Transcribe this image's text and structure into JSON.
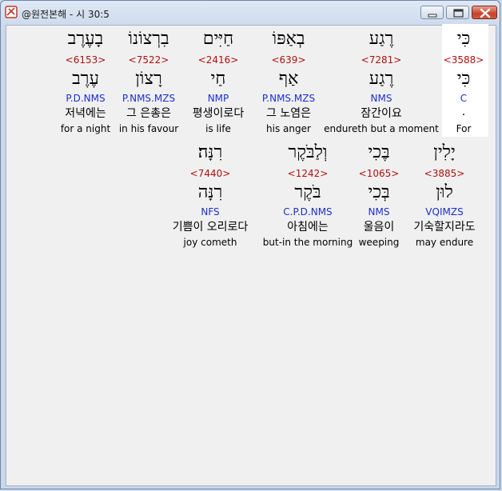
{
  "window": {
    "title": "@원전본해 - 시 30:5"
  },
  "row1": [
    {
      "text": "בָעֶרֶב",
      "strong": "<6153>",
      "lemma": "עֶרֶב",
      "parsing": "P.D.NMS",
      "korean": "저녁에는",
      "english": "for a night"
    },
    {
      "text": "בִרְצוֹנוֹ",
      "strong": "<7522>",
      "lemma": "רָצוֹן",
      "parsing": "P.NMS.MZS",
      "korean": "그 은총은",
      "english": "in his favour"
    },
    {
      "text": "חַיִּים",
      "strong": "<2416>",
      "lemma": "חַי",
      "parsing": "NMP",
      "korean": "평생이로다",
      "english": "is life"
    },
    {
      "text": "בְאַפּוֹ",
      "strong": "<639>",
      "lemma": "אַף",
      "parsing": "P.NMS.MZS",
      "korean": "그 노염은",
      "english": "his anger"
    },
    {
      "text": "רֶגַע",
      "strong": "<7281>",
      "lemma": "רֶגַע",
      "parsing": "NMS",
      "korean": "잠간이요",
      "english": "endureth but a moment"
    },
    {
      "text": "כִּי",
      "strong": "<3588>",
      "lemma": "כִּי",
      "parsing": "C",
      "korean": ".",
      "english": "For"
    }
  ],
  "row2": [
    {
      "text": "רִנָּה׃",
      "strong": "<7440>",
      "lemma": "רִנָּה",
      "parsing": "NFS",
      "korean": "기쁨이 오리로다",
      "english": "joy cometh"
    },
    {
      "text": "וְלַבֹּקֶר",
      "strong": "<1242>",
      "lemma": "בֹּקֶר",
      "parsing": "C.P.D.NMS",
      "korean": "아침에는",
      "english": "but-in the morning"
    },
    {
      "text": "בֶּכִי",
      "strong": "<1065>",
      "lemma": "בְּכִי",
      "parsing": "NMS",
      "korean": "울음이",
      "english": "weeping"
    },
    {
      "text": "יָלִין",
      "strong": "<3885>",
      "lemma": "לוּן",
      "parsing": "VQIMZS",
      "korean": "기숙할지라도",
      "english": "may endure"
    }
  ]
}
